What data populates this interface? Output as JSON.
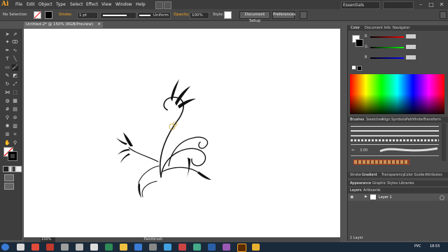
{
  "app": {
    "logo": "Ai"
  },
  "menu": [
    "File",
    "Edit",
    "Object",
    "Type",
    "Select",
    "Effect",
    "View",
    "Window",
    "Help"
  ],
  "workspace": {
    "label": "Essentials"
  },
  "window_controls": {
    "minimize": "–",
    "maximize": "□",
    "close": "✕"
  },
  "control_bar": {
    "selection_label": "No Selection",
    "stroke_label": "Stroke:",
    "stroke_weight": "1 pt",
    "profile_label": "Uniform",
    "opacity_label": "Opacity:",
    "opacity_value": "100%",
    "style_label": "Style:",
    "document_setup": "Document Setup",
    "preferences": "Preferences"
  },
  "document": {
    "tab_title": "Untitled-2* @ 150% (RGB/Preview)",
    "close": "✕"
  },
  "status_bar": {
    "zoom": "150%",
    "tool": "Paintbrush"
  },
  "panels": {
    "color_tabs": [
      "Color",
      "Document Info",
      "Navigator"
    ],
    "color_channels": [
      "R",
      "G",
      "B"
    ],
    "brushes_tabs": [
      "Brushes",
      "Swatches",
      "Align",
      "Symbols",
      "Pathfinder",
      "Transform"
    ],
    "brush_size": "3.00",
    "stroke_tabs": [
      "Stroke",
      "Gradient",
      "Transparency",
      "Color Guide",
      "Attributes"
    ],
    "appearance_tabs": [
      "Appearance",
      "Graphic Styles",
      "Libraries"
    ],
    "layers_tabs": [
      "Layers",
      "Artboards"
    ],
    "layer_name": "Layer 1",
    "layers_count": "1 Layer"
  },
  "taskbar": {
    "language": "РУС",
    "time": "18:55"
  }
}
